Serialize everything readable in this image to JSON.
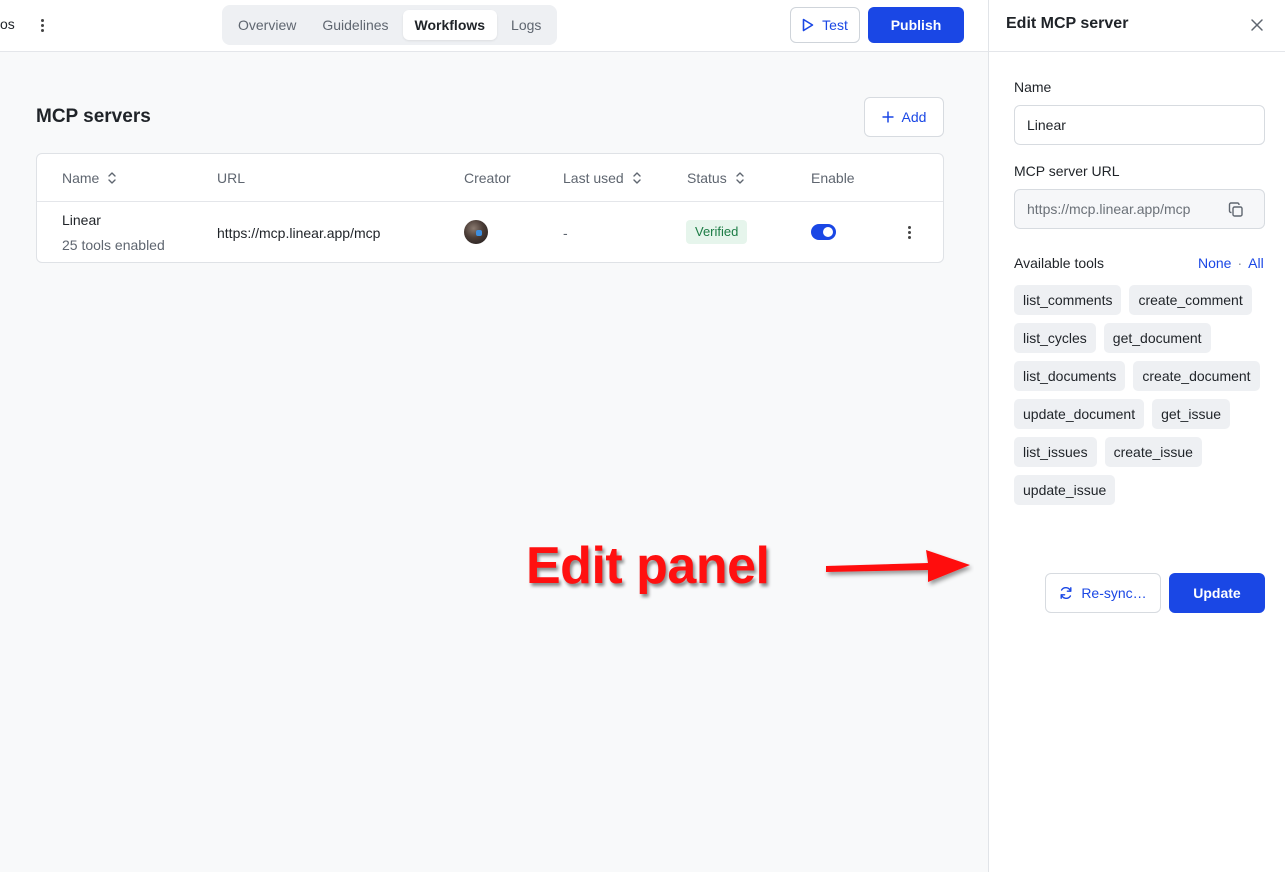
{
  "topbar": {
    "crumb_fragment": "os",
    "tabs": [
      {
        "label": "Overview"
      },
      {
        "label": "Guidelines"
      },
      {
        "label": "Workflows"
      },
      {
        "label": "Logs"
      }
    ],
    "active_tab": "Workflows",
    "test_label": "Test",
    "publish_label": "Publish"
  },
  "main": {
    "title": "MCP servers",
    "add_label": "Add",
    "table": {
      "columns": [
        "Name",
        "URL",
        "Creator",
        "Last used",
        "Status",
        "Enable"
      ],
      "rows": [
        {
          "name": "Linear",
          "subtitle": "25 tools enabled",
          "url": "https://mcp.linear.app/mcp",
          "last_used": "-",
          "status": "Verified",
          "enabled": true
        }
      ]
    }
  },
  "annotation": {
    "text": "Edit panel"
  },
  "panel": {
    "title": "Edit MCP server",
    "name_label": "Name",
    "name_value": "Linear",
    "url_label": "MCP server URL",
    "url_value": "https://mcp.linear.app/mcp",
    "tools_label": "Available tools",
    "none_label": "None",
    "all_label": "All",
    "tools": [
      "list_comments",
      "create_comment",
      "list_cycles",
      "get_document",
      "list_documents",
      "create_document",
      "update_document",
      "get_issue",
      "list_issues",
      "create_issue",
      "update_issue"
    ],
    "resync_label": "Re-sync…",
    "update_label": "Update"
  },
  "colors": {
    "accent": "#1a47e5",
    "verified_bg": "#e6f5ec",
    "verified_text": "#1c7c45",
    "annotation": "#ff1010"
  }
}
